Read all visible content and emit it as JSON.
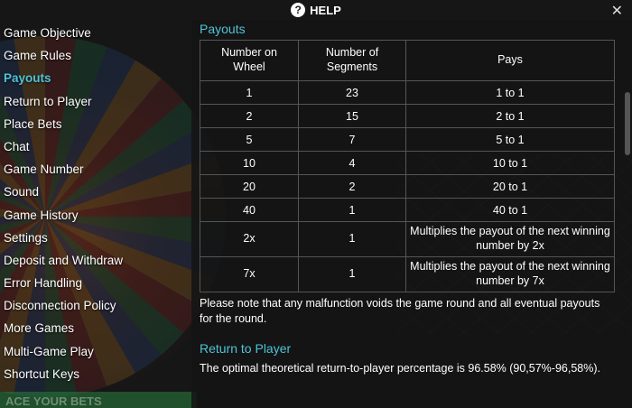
{
  "header": {
    "title": "HELP",
    "help_icon": "question-icon",
    "close_label": "✕"
  },
  "sidebar": {
    "items": [
      {
        "label": "Game Objective",
        "active": false
      },
      {
        "label": "Game Rules",
        "active": false
      },
      {
        "label": "Payouts",
        "active": true
      },
      {
        "label": "Return to Player",
        "active": false
      },
      {
        "label": "Place Bets",
        "active": false
      },
      {
        "label": "Chat",
        "active": false
      },
      {
        "label": "Game Number",
        "active": false
      },
      {
        "label": "Sound",
        "active": false
      },
      {
        "label": "Game History",
        "active": false
      },
      {
        "label": "Settings",
        "active": false
      },
      {
        "label": "Deposit and Withdraw",
        "active": false
      },
      {
        "label": "Error Handling",
        "active": false
      },
      {
        "label": "Disconnection Policy",
        "active": false
      },
      {
        "label": "More Games",
        "active": false
      },
      {
        "label": "Multi-Game Play",
        "active": false
      },
      {
        "label": "Shortcut Keys",
        "active": false
      }
    ],
    "footer_text": "ACE YOUR BETS"
  },
  "payouts": {
    "title": "Payouts",
    "headers": {
      "number": "Number on Wheel",
      "segments": "Number of Segments",
      "pays": "Pays"
    },
    "rows": [
      {
        "number": "1",
        "segments": "23",
        "pays": "1 to 1"
      },
      {
        "number": "2",
        "segments": "15",
        "pays": "2 to 1"
      },
      {
        "number": "5",
        "segments": "7",
        "pays": "5 to 1"
      },
      {
        "number": "10",
        "segments": "4",
        "pays": "10 to 1"
      },
      {
        "number": "20",
        "segments": "2",
        "pays": "20 to 1"
      },
      {
        "number": "40",
        "segments": "1",
        "pays": "40 to 1"
      },
      {
        "number": "2x",
        "segments": "1",
        "pays": "Multiplies the payout of the next winning number by 2x"
      },
      {
        "number": "7x",
        "segments": "1",
        "pays": "Multiplies the payout of the next winning number by 7x"
      }
    ],
    "note": "Please note that any malfunction voids the game round and all eventual payouts for the round."
  },
  "rtp": {
    "title": "Return to Player",
    "text": "The optimal theoretical return-to-player percentage is 96.58% (90,57%-96,58%)."
  },
  "colors": {
    "accent": "#4fc3d7"
  }
}
